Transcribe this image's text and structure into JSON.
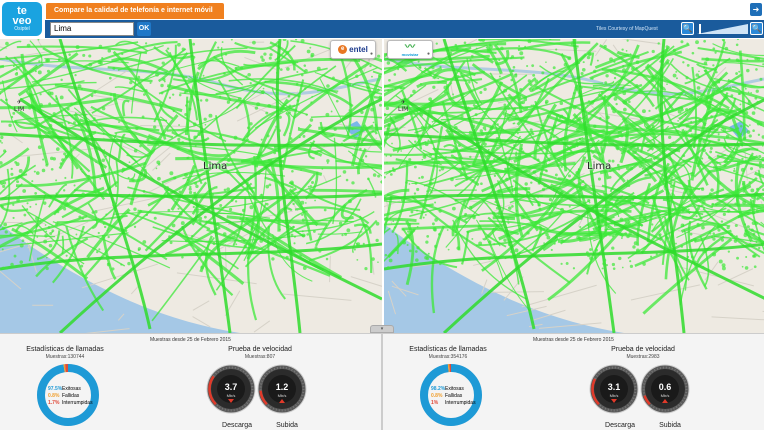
{
  "app": {
    "logo_top": "te",
    "logo_bottom": "veo",
    "logo_sub": "Osiptel",
    "title": "Compare la calidad de telefonía e internet móvil",
    "exit_icon": "exit-icon"
  },
  "toolbar": {
    "search_value": "Lima",
    "ok_label": "OK",
    "tiles_credit": "Tiles Courtesy of MapQuest",
    "zoom_out_icon": "search-minus-icon",
    "zoom_in_icon": "search-plus-icon",
    "zoom_level": 0.05
  },
  "maps": {
    "left": {
      "city_label": "Lima",
      "airport_label": "LIM",
      "operator": "entel"
    },
    "right": {
      "city_label": "Lima",
      "airport_label": "LIM",
      "operator": "movistar"
    }
  },
  "panels": {
    "left": {
      "samples_since": "Muestras desde 25 de Febrero 2015",
      "calls_title": "Estadísticas de llamadas",
      "calls_samples": "Muestras:130744",
      "calls": [
        {
          "pct": "97.5%",
          "label": "Exitosas",
          "value": 97.5,
          "color": "#1e9ad6"
        },
        {
          "pct": "0.8%",
          "label": "Fallidas",
          "value": 0.8,
          "color": "#f0a030"
        },
        {
          "pct": "1.7%",
          "label": "Interrumpidas",
          "value": 1.7,
          "color": "#e04a3a"
        }
      ],
      "speed_title": "Prueba de velocidad",
      "speed_samples": "Muestras:807",
      "download": {
        "value": "3.7",
        "unit": "Mb/s",
        "caption": "Descarga",
        "level": 0.3
      },
      "upload": {
        "value": "1.2",
        "unit": "Mb/s",
        "caption": "Subida",
        "level": 0.15
      }
    },
    "right": {
      "samples_since": "Muestras desde 25 de Febrero 2015",
      "calls_title": "Estadísticas de llamadas",
      "calls_samples": "Muestras:354176",
      "calls": [
        {
          "pct": "98.2%",
          "label": "Exitosas",
          "value": 98.2,
          "color": "#1e9ad6"
        },
        {
          "pct": "0.8%",
          "label": "Fallidas",
          "value": 0.8,
          "color": "#f0a030"
        },
        {
          "pct": "1%",
          "label": "Interrumpidas",
          "value": 1.0,
          "color": "#e04a3a"
        }
      ],
      "speed_title": "Prueba de velocidad",
      "speed_samples": "Muestras:2983",
      "download": {
        "value": "3.1",
        "unit": "Mb/s",
        "caption": "Descarga",
        "level": 0.27
      },
      "upload": {
        "value": "0.6",
        "unit": "Mb/s",
        "caption": "Subida",
        "level": 0.1
      }
    }
  },
  "colors": {
    "brand_orange": "#f0801f",
    "toolbar_blue": "#1a5b9c",
    "coverage_green": "#3ee83a",
    "sea": "#a5c8e6"
  }
}
